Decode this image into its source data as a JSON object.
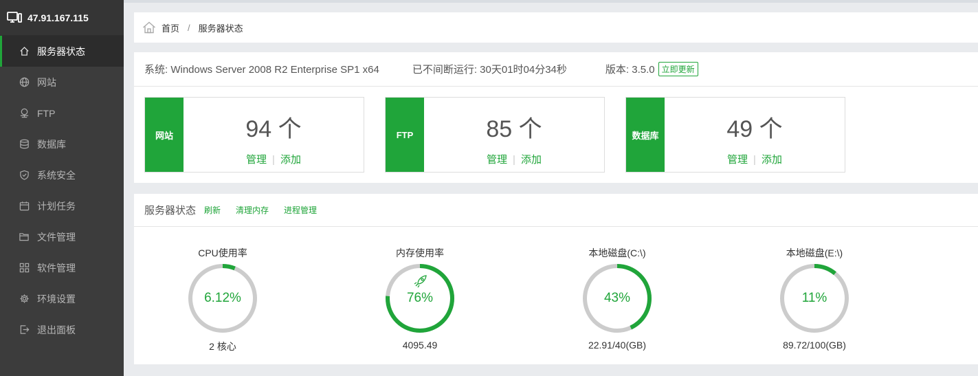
{
  "sidebar": {
    "host": "47.91.167.115",
    "items": [
      {
        "label": "服务器状态",
        "icon": "home-icon"
      },
      {
        "label": "网站",
        "icon": "globe-icon"
      },
      {
        "label": "FTP",
        "icon": "ftp-icon"
      },
      {
        "label": "数据库",
        "icon": "database-icon"
      },
      {
        "label": "系统安全",
        "icon": "shield-icon"
      },
      {
        "label": "计划任务",
        "icon": "calendar-icon"
      },
      {
        "label": "文件管理",
        "icon": "folder-icon"
      },
      {
        "label": "软件管理",
        "icon": "grid-icon"
      },
      {
        "label": "环境设置",
        "icon": "gear-icon"
      },
      {
        "label": "退出面板",
        "icon": "logout-icon"
      }
    ]
  },
  "breadcrumb": {
    "home": "首页",
    "sep": "/",
    "current": "服务器状态"
  },
  "info": {
    "system": "系统: Windows Server 2008 R2 Enterprise SP1 x64",
    "uptime": "已不间断运行: 30天01时04分34秒",
    "version": "版本: 3.5.0",
    "update_button": "立即更新"
  },
  "cards": [
    {
      "tag": "网站",
      "count": "94 个",
      "manage": "管理",
      "add": "添加"
    },
    {
      "tag": "FTP",
      "count": "85 个",
      "manage": "管理",
      "add": "添加"
    },
    {
      "tag": "数据库",
      "count": "49 个",
      "manage": "管理",
      "add": "添加"
    }
  ],
  "status": {
    "title": "服务器状态",
    "refresh": "刷新",
    "clear_mem": "清理内存",
    "process": "进程管理",
    "gauges": [
      {
        "label": "CPU使用率",
        "value": 6.12,
        "percent_text": "6.12%",
        "sub": "2 核心"
      },
      {
        "label": "内存使用率",
        "value": 76,
        "percent_text": "76%",
        "sub": "4095.49"
      },
      {
        "label": "本地磁盘(C:\\)",
        "value": 43,
        "percent_text": "43%",
        "sub": "22.91/40(GB)"
      },
      {
        "label": "本地磁盘(E:\\)",
        "value": 11,
        "percent_text": "11%",
        "sub": "89.72/100(GB)"
      }
    ]
  },
  "colors": {
    "accent": "#20a53a",
    "ring_bg": "#cccccc",
    "sidebar": "#3c3c3c"
  }
}
